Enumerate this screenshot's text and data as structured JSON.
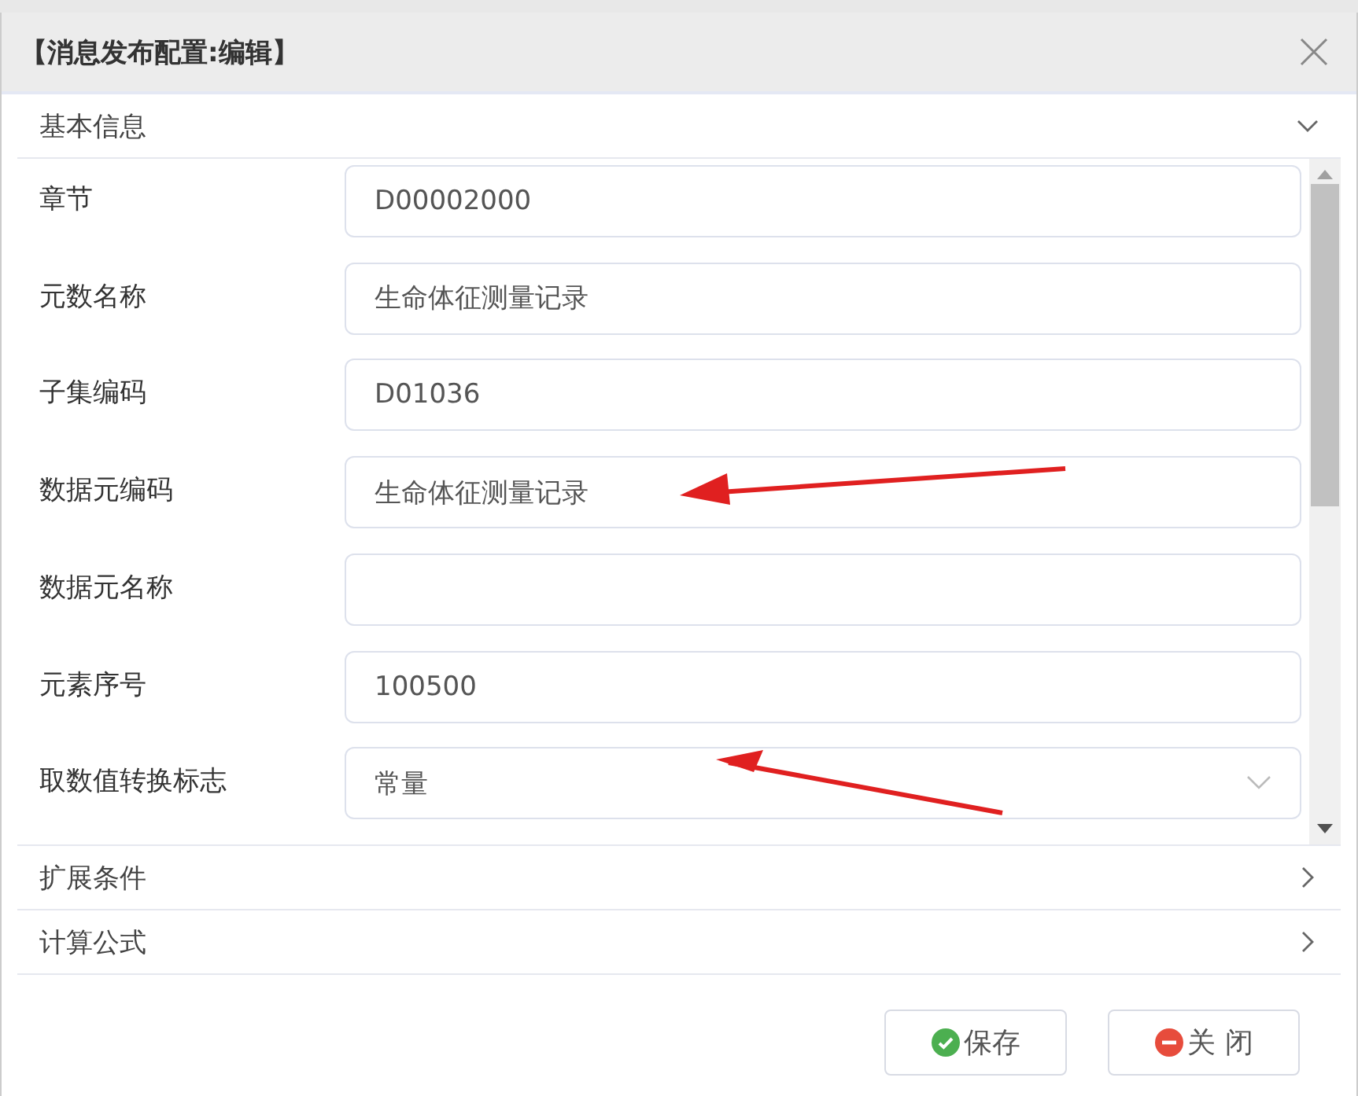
{
  "dialog": {
    "title": "【消息发布配置:编辑】"
  },
  "sections": [
    {
      "title": "基本信息",
      "expanded": true,
      "fields": [
        {
          "kind": "text",
          "label": "章节",
          "value": "D00002000",
          "marked": false
        },
        {
          "kind": "text",
          "label": "元数名称",
          "value": "生命体征测量记录",
          "marked": false
        },
        {
          "kind": "text",
          "label": "子集编码",
          "value": "D01036",
          "marked": false
        },
        {
          "kind": "text",
          "label": "数据元编码",
          "value": "生命体征测量记录",
          "marked": true
        },
        {
          "kind": "text",
          "label": "数据元名称",
          "marked": false
        },
        {
          "kind": "text",
          "label": "元素序号",
          "value": "100500",
          "marked": false
        },
        {
          "kind": "select",
          "label": "取数值转换标志",
          "value": "常量",
          "marked": true
        }
      ]
    },
    {
      "title": "扩展条件",
      "expanded": false
    },
    {
      "title": "计算公式",
      "expanded": false
    }
  ],
  "buttons": [
    {
      "kind": "save",
      "label": "保存"
    },
    {
      "kind": "close",
      "label": "关 闭"
    }
  ]
}
